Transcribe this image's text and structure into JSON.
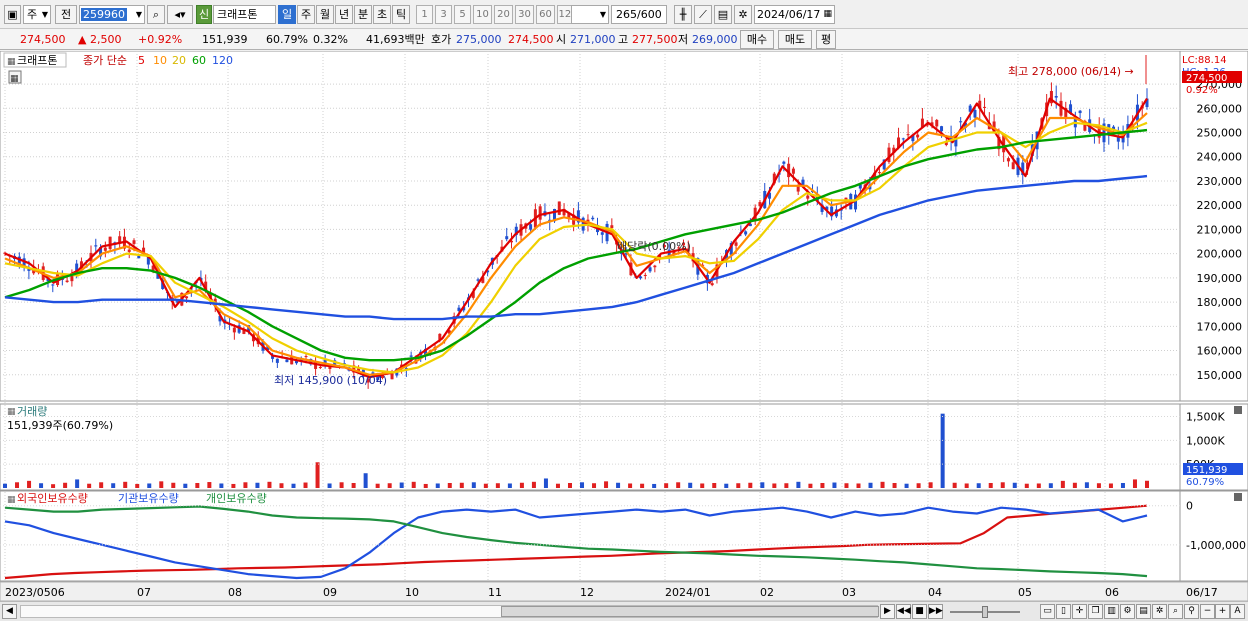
{
  "toolbar": {
    "period_type": "주",
    "mode": "전",
    "code": "259960",
    "shin": "신",
    "name": "크래프톤",
    "periods": [
      "일",
      "주",
      "월",
      "년",
      "분",
      "초",
      "틱"
    ],
    "active_period": "일",
    "tick_numbers": [
      "1",
      "3",
      "5",
      "10",
      "20",
      "30",
      "60",
      "120"
    ],
    "count": "265",
    "count_max": "/600",
    "date": "2024/06/17"
  },
  "quote": {
    "price": "274,500",
    "change": "▲   2,500",
    "rate": "+0.92%",
    "volume": "151,939",
    "vol_ratio": "60.79%",
    "turnover": "0.32%",
    "amount": "41,693백만",
    "ask_label": "호가",
    "ask": "275,000",
    "bid": "274,500",
    "open_label": "시",
    "open": "271,000",
    "high_label": "고",
    "high": "277,500",
    "low_label": "저",
    "low": "269,000",
    "buy_label": "매수",
    "sell_label": "매도",
    "eval_label": "평"
  },
  "legend": {
    "name": "크래프톤",
    "ma_label": "종가 단순",
    "ma_periods": [
      "5",
      "10",
      "20",
      "60",
      "120"
    ],
    "ma_colors": [
      "#e00000",
      "#ff8c00",
      "#f0d000",
      "#00a000",
      "#2050e0"
    ],
    "lc": "LC:88.14",
    "hc": "HC:-1.26"
  },
  "price_panel": {
    "high_note": "최고 278,000 (06/14) →",
    "low_note": "최저 145,900 (10/04)",
    "dividend_note": "배당락(0.00%)",
    "current_tag": "274,500",
    "change_tag": "0.92%"
  },
  "volume_panel": {
    "title": "거래량",
    "info": "151,939주(60.79%)",
    "current_tag": "151,939",
    "ratio_tag": "60.79%"
  },
  "holding_panel": {
    "series_names": [
      "외국인보유수량",
      "기관보유수량",
      "개인보유수량"
    ],
    "series_colors": [
      "#d81010",
      "#2050e0",
      "#209040"
    ]
  },
  "x_axis": {
    "labels": [
      "2023/0506",
      "07",
      "08",
      "09",
      "10",
      "11",
      "12",
      "2024/01",
      "02",
      "03",
      "04",
      "05",
      "06",
      "06/17"
    ]
  },
  "chart_data": [
    {
      "type": "line",
      "title": "",
      "y_ticks": [
        150000,
        160000,
        170000,
        180000,
        190000,
        200000,
        210000,
        220000,
        230000,
        240000,
        250000,
        260000,
        270000
      ],
      "ylim": [
        140000,
        282000
      ],
      "low_point": {
        "date": "10/04",
        "value": 145900
      },
      "high_point": {
        "date": "06/14",
        "value": 278000
      },
      "last_close": 274500,
      "x_months": [
        "2023/05",
        "2023/06",
        "2023/07",
        "2023/08",
        "2023/09",
        "2023/10",
        "2023/11",
        "2023/12",
        "2024/01",
        "2024/02",
        "2024/03",
        "2024/04",
        "2024/05",
        "2024/06"
      ],
      "series": [
        {
          "name": "5",
          "values": [
            200000,
            196000,
            188000,
            193000,
            203000,
            205000,
            198000,
            178000,
            190000,
            172000,
            168000,
            158000,
            156000,
            154000,
            153000,
            149000,
            151000,
            158000,
            165000,
            180000,
            196000,
            208000,
            216000,
            218000,
            212000,
            208000,
            190000,
            200000,
            202000,
            188000,
            205000,
            217000,
            236000,
            226000,
            216000,
            222000,
            236000,
            246000,
            254000,
            246000,
            262000,
            246000,
            232000,
            264000,
            257000,
            250000,
            248000,
            264000
          ]
        },
        {
          "name": "10",
          "values": [
            198000,
            194000,
            190000,
            192000,
            200000,
            203000,
            199000,
            182000,
            185000,
            175000,
            170000,
            160000,
            157000,
            155000,
            153000,
            150000,
            151000,
            156000,
            163000,
            175000,
            190000,
            203000,
            212000,
            215000,
            213000,
            209000,
            195000,
            198000,
            201000,
            192000,
            200000,
            212000,
            228000,
            228000,
            220000,
            222000,
            232000,
            242000,
            250000,
            248000,
            256000,
            250000,
            238000,
            256000,
            256000,
            252000,
            249000,
            258000
          ]
        },
        {
          "name": "20",
          "values": [
            196000,
            194000,
            192000,
            191000,
            196000,
            200000,
            199000,
            188000,
            183000,
            178000,
            172000,
            165000,
            160000,
            157000,
            154000,
            152000,
            151000,
            153000,
            158000,
            167000,
            180000,
            195000,
            206000,
            211000,
            212000,
            210000,
            200000,
            198000,
            199000,
            196000,
            197000,
            206000,
            218000,
            225000,
            222000,
            222000,
            227000,
            236000,
            244000,
            247000,
            250000,
            250000,
            244000,
            250000,
            254000,
            253000,
            250000,
            254000
          ]
        },
        {
          "name": "60",
          "values": [
            182000,
            185000,
            189000,
            192000,
            194000,
            194000,
            193000,
            190000,
            186000,
            181000,
            176000,
            170000,
            165000,
            160000,
            157000,
            156000,
            156000,
            157000,
            160000,
            166000,
            173000,
            180000,
            188000,
            194000,
            198000,
            200000,
            202000,
            205000,
            208000,
            210000,
            212000,
            214000,
            217000,
            221000,
            225000,
            228000,
            232000,
            236000,
            239000,
            241000,
            243000,
            244000,
            246000,
            247000,
            248000,
            249000,
            250000,
            251000
          ]
        },
        {
          "name": "120",
          "values": [
            182000,
            181000,
            180000,
            180000,
            181000,
            181000,
            181000,
            181000,
            180000,
            179000,
            178000,
            177000,
            176000,
            175000,
            174000,
            174000,
            173000,
            173000,
            173000,
            174000,
            174000,
            175000,
            175000,
            176000,
            177000,
            178000,
            180000,
            183000,
            186000,
            189000,
            192000,
            196000,
            200000,
            204000,
            208000,
            212000,
            216000,
            219000,
            222000,
            224000,
            226000,
            227000,
            228000,
            229000,
            230000,
            230000,
            231000,
            232000
          ]
        }
      ]
    },
    {
      "type": "bar",
      "title": "",
      "y_ticks": [
        500000,
        1000000,
        1500000
      ],
      "y_tick_labels": [
        "500K",
        "1,000K",
        "1,500K"
      ],
      "ylim": [
        0,
        1700000
      ],
      "last_value": 151939,
      "values": [
        90000,
        120000,
        150000,
        100000,
        80000,
        110000,
        180000,
        90000,
        120000,
        100000,
        130000,
        85000,
        95000,
        140000,
        110000,
        90000,
        105000,
        125000,
        95000,
        85000,
        120000,
        110000,
        130000,
        100000,
        90000,
        115000,
        540000,
        95000,
        120000,
        105000,
        310000,
        90000,
        100000,
        115000,
        130000,
        85000,
        95000,
        105000,
        110000,
        120000,
        90000,
        100000,
        95000,
        110000,
        130000,
        200000,
        90000,
        105000,
        120000,
        100000,
        140000,
        110000,
        95000,
        90000,
        85000,
        100000,
        120000,
        110000,
        95000,
        105000,
        90000,
        100000,
        110000,
        120000,
        95000,
        100000,
        130000,
        90000,
        105000,
        115000,
        100000,
        95000,
        110000,
        130000,
        105000,
        90000,
        100000,
        120000,
        1560000,
        110000,
        95000,
        100000,
        105000,
        120000,
        110000,
        90000,
        95000,
        100000,
        150000,
        110000,
        120000,
        100000,
        95000,
        105000,
        180000,
        151939
      ]
    },
    {
      "type": "line",
      "title": "",
      "y_ticks": [
        0,
        -1000000
      ],
      "y_tick_labels": [
        "0",
        "-1,000,000"
      ],
      "ylim": [
        -1900000,
        300000
      ],
      "series": [
        {
          "name": "외국인보유수량",
          "values": [
            -1850000,
            -1800000,
            -1750000,
            -1720000,
            -1700000,
            -1680000,
            -1660000,
            -1650000,
            -1640000,
            -1620000,
            -1600000,
            -1590000,
            -1580000,
            -1560000,
            -1540000,
            -1520000,
            -1500000,
            -1470000,
            -1440000,
            -1420000,
            -1400000,
            -1380000,
            -1360000,
            -1340000,
            -1320000,
            -1300000,
            -1280000,
            -1250000,
            -1220000,
            -1200000,
            -1180000,
            -1160000,
            -1130000,
            -1100000,
            -1070000,
            -1050000,
            -1030000,
            -1000000,
            -990000,
            -980000,
            -970000,
            -960000,
            -700000,
            -300000,
            -250000,
            -200000,
            -150000,
            -100000,
            -50000,
            0
          ]
        },
        {
          "name": "기관보유수량",
          "values": [
            -400000,
            -500000,
            -700000,
            -850000,
            -1000000,
            -1150000,
            -1300000,
            -1450000,
            -1550000,
            -1650000,
            -1750000,
            -1800000,
            -1850000,
            -1820000,
            -1600000,
            -1200000,
            -700000,
            -300000,
            -150000,
            -100000,
            -150000,
            -100000,
            -300000,
            -250000,
            -200000,
            -150000,
            -100000,
            -150000,
            -100000,
            -250000,
            -150000,
            -100000,
            -50000,
            -150000,
            -300000,
            -150000,
            -250000,
            -200000,
            -50000,
            -150000,
            -200000,
            -50000,
            -100000,
            -200000,
            -150000,
            -100000,
            -400000,
            -250000
          ]
        },
        {
          "name": "개인보유수량",
          "values": [
            -50000,
            -100000,
            -150000,
            -150000,
            -100000,
            -80000,
            -60000,
            -40000,
            -20000,
            -80000,
            -150000,
            -250000,
            -300000,
            -320000,
            -330000,
            -350000,
            -400000,
            -550000,
            -700000,
            -800000,
            -880000,
            -950000,
            -1000000,
            -1050000,
            -1100000,
            -1120000,
            -1150000,
            -1180000,
            -1200000,
            -1220000,
            -1250000,
            -1280000,
            -1300000,
            -1320000,
            -1350000,
            -1380000,
            -1420000,
            -1450000,
            -1500000,
            -1550000,
            -1600000,
            -1620000,
            -1650000,
            -1680000,
            -1700000,
            -1720000,
            -1750000,
            -1800000
          ]
        }
      ]
    }
  ]
}
